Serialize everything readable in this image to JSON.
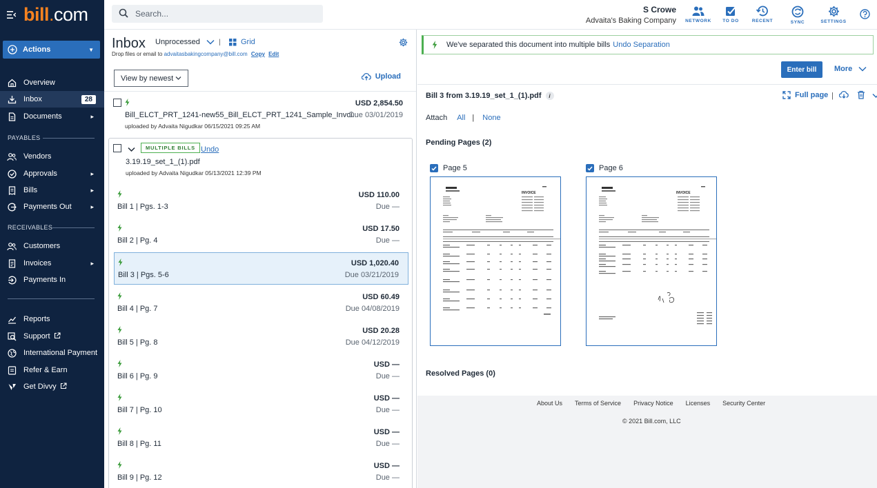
{
  "brand": {
    "logo_bill": "bill",
    "logo_dot": ".",
    "logo_com": "com"
  },
  "sidebar": {
    "actions_label": "Actions",
    "items": [
      {
        "label": "Overview"
      },
      {
        "label": "Inbox",
        "badge": "28"
      },
      {
        "label": "Documents"
      },
      {
        "label": "Vendors"
      },
      {
        "label": "Approvals"
      },
      {
        "label": "Bills"
      },
      {
        "label": "Payments Out"
      },
      {
        "label": "Customers"
      },
      {
        "label": "Invoices"
      },
      {
        "label": "Payments In"
      },
      {
        "label": "Reports"
      },
      {
        "label": "Support"
      },
      {
        "label": "International Payment"
      },
      {
        "label": "Refer & Earn"
      },
      {
        "label": "Get Divvy"
      }
    ],
    "section_payables": "PAYABLES",
    "section_receivables": "RECEIVABLES"
  },
  "topbar": {
    "search_placeholder": "Search...",
    "user_name": "S Crowe",
    "company": "Advaita's Baking Company",
    "icons": [
      {
        "label": "NETWORK"
      },
      {
        "label": "TO DO"
      },
      {
        "label": "RECENT"
      },
      {
        "label": "SYNC"
      },
      {
        "label": "SETTINGS"
      }
    ]
  },
  "inbox": {
    "title": "Inbox",
    "filter": "Unprocessed",
    "separator": "|",
    "grid_label": "Grid",
    "drop_text": "Drop files or email to",
    "email": "advaitasbakingcompany@bill.com",
    "copy": "Copy",
    "edit": "Edit",
    "view_select": "View by newest",
    "upload": "Upload",
    "file1": {
      "name": "Bill_ELCT_PRT_1241-new55_Bill_ELCT_PRT_1241_Sample_Invoi...",
      "meta": "uploaded by Advaita Nigudkar 06/15/2021 09:25 AM",
      "amount": "USD 2,854.50",
      "due": "Due 03/01/2019"
    },
    "group": {
      "tag": "MULTIPLE BILLS",
      "undo": "Undo",
      "name": "3.19.19_set_1_(1).pdf",
      "meta": "uploaded by Advaita Nigudkar 05/13/2021 12:39 PM"
    },
    "bills": [
      {
        "label": "Bill 1",
        "pages": "Pgs. 1-3",
        "amount": "USD 110.00",
        "due": "Due —"
      },
      {
        "label": "Bill 2",
        "pages": "Pg. 4",
        "amount": "USD 17.50",
        "due": "Due —"
      },
      {
        "label": "Bill 3",
        "pages": "Pgs. 5-6",
        "amount": "USD 1,020.40",
        "due": "Due 03/21/2019"
      },
      {
        "label": "Bill 4",
        "pages": "Pg. 7",
        "amount": "USD 60.49",
        "due": "Due 04/08/2019"
      },
      {
        "label": "Bill 5",
        "pages": "Pg. 8",
        "amount": "USD 20.28",
        "due": "Due 04/12/2019"
      },
      {
        "label": "Bill 6",
        "pages": "Pg. 9",
        "amount": "USD —",
        "due": "Due —"
      },
      {
        "label": "Bill 7",
        "pages": "Pg. 10",
        "amount": "USD —",
        "due": "Due —"
      },
      {
        "label": "Bill 8",
        "pages": "Pg. 11",
        "amount": "USD —",
        "due": "Due —"
      },
      {
        "label": "Bill 9",
        "pages": "Pg. 12",
        "amount": "USD —",
        "due": "Due —"
      }
    ]
  },
  "detail": {
    "notice": "We've separated this document into multiple bills",
    "undo_separation": "Undo Separation",
    "enter_bill": "Enter bill",
    "more": "More",
    "bill_title": "Bill 3 from 3.19.19_set_1_(1).pdf",
    "info": "i",
    "full_page": "Full page",
    "attach": "Attach",
    "attach_all": "All",
    "attach_sep": "|",
    "attach_none": "None",
    "pending": "Pending Pages (2)",
    "pages": [
      {
        "label": "Page 5"
      },
      {
        "label": "Page 6"
      }
    ],
    "thumb_title": "INVOICE",
    "resolved": "Resolved Pages (0)"
  },
  "footer": {
    "links": [
      "About Us",
      "Terms of Service",
      "Privacy Notice",
      "Licenses",
      "Security Center"
    ],
    "copyright": "© 2021 Bill.com, LLC"
  },
  "colors": {
    "sidebar": "#0f2340",
    "accent": "#2a6ebb",
    "logo": "#f58220",
    "success": "#4caf50"
  }
}
